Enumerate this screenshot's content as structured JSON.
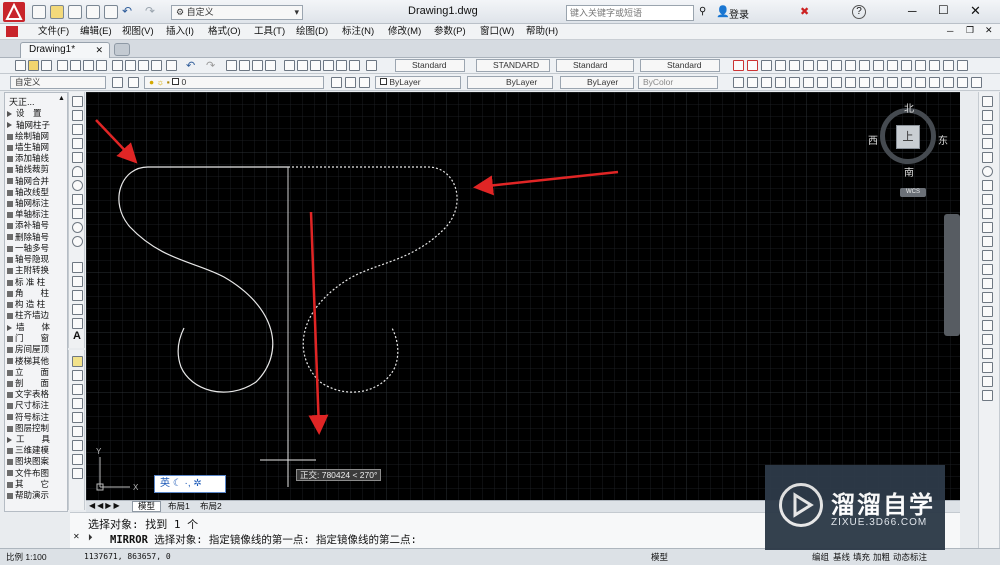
{
  "title": {
    "workspace": "自定义",
    "filename": "Drawing1.dwg",
    "search_placeholder": "键入关键字或短语",
    "login": "登录",
    "help": "?"
  },
  "menu": [
    "文件(F)",
    "编辑(E)",
    "视图(V)",
    "插入(I)",
    "格式(O)",
    "工具(T)",
    "绘图(D)",
    "标注(N)",
    "修改(M)",
    "参数(P)",
    "窗口(W)",
    "帮助(H)"
  ],
  "doc_tab": "Drawing1*",
  "toolbar": {
    "text_style": "Standard",
    "dim_style": "STANDARD",
    "table_style": "Standard",
    "mleader_style": "Standard",
    "workspace2": "自定义",
    "layer": "0",
    "color": "ByLayer",
    "linetype": "ByLayer",
    "lineweight": "ByLayer",
    "plotstyle": "ByColor"
  },
  "left_panel": {
    "header": "天正...",
    "items": [
      "设　置",
      "轴网柱子",
      "绘制轴网",
      "墙生轴网",
      "添加轴线",
      "轴线裁剪",
      "轴网合并",
      "轴改线型",
      "轴网标注",
      "单轴标注",
      "添补轴号",
      "删除轴号",
      "一轴多号",
      "轴号隐现",
      "主附转换",
      "标 准 柱",
      "角　　柱",
      "构 造 柱",
      "柱齐墙边",
      "墙　　体",
      "门　　窗",
      "房间屋顶",
      "楼梯其他",
      "立　　面",
      "剖　　面",
      "文字表格",
      "尺寸标注",
      "符号标注",
      "图层控制",
      "工　　具",
      "三维建模",
      "图块图案",
      "文件布图",
      "其　　它",
      "帮助演示"
    ]
  },
  "viewcube": {
    "north": "北",
    "south": "南",
    "east": "东",
    "west": "西",
    "top": "上",
    "ucs": "WCS"
  },
  "canvas": {
    "tooltip": "正交: 780424 < 270°",
    "ime": "英"
  },
  "layout_tabs": [
    "模型",
    "布局1",
    "布局2"
  ],
  "command": {
    "line1": "选择对象: 找到 1 个",
    "prompt_cmd": "MIRROR",
    "line2": "选择对象:  指定镜像线的第一点:  指定镜像线的第二点:"
  },
  "status": {
    "scale": "比例 1:100",
    "coords": "1137671, 863657, 0",
    "model": "模型",
    "items": [
      "编组",
      "基线",
      "填充",
      "加粗",
      "动态标注"
    ]
  },
  "watermark": {
    "brand": "溜溜自学",
    "url": "ZIXUE.3D66.COM"
  }
}
